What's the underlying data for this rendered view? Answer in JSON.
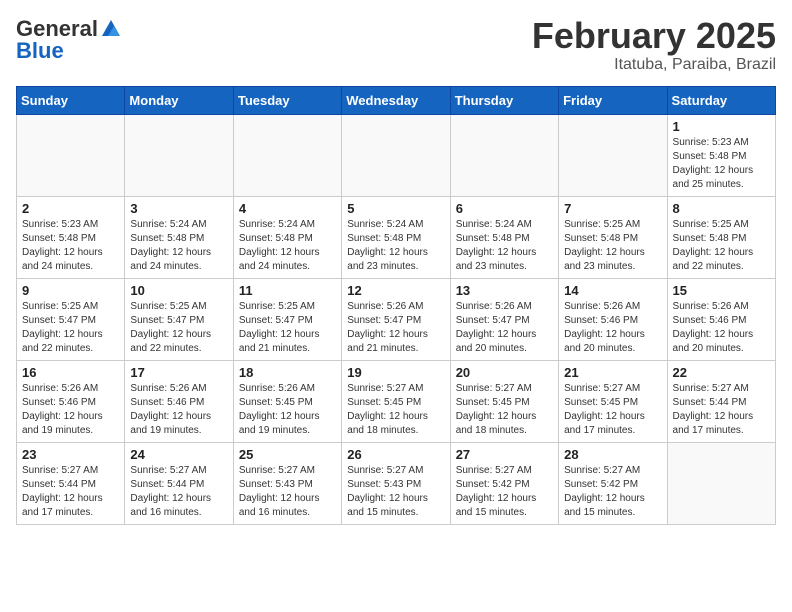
{
  "header": {
    "logo_general": "General",
    "logo_blue": "Blue",
    "cal_title": "February 2025",
    "cal_subtitle": "Itatuba, Paraiba, Brazil"
  },
  "weekdays": [
    "Sunday",
    "Monday",
    "Tuesday",
    "Wednesday",
    "Thursday",
    "Friday",
    "Saturday"
  ],
  "weeks": [
    [
      {
        "day": "",
        "info": ""
      },
      {
        "day": "",
        "info": ""
      },
      {
        "day": "",
        "info": ""
      },
      {
        "day": "",
        "info": ""
      },
      {
        "day": "",
        "info": ""
      },
      {
        "day": "",
        "info": ""
      },
      {
        "day": "1",
        "info": "Sunrise: 5:23 AM\nSunset: 5:48 PM\nDaylight: 12 hours and 25 minutes."
      }
    ],
    [
      {
        "day": "2",
        "info": "Sunrise: 5:23 AM\nSunset: 5:48 PM\nDaylight: 12 hours and 24 minutes."
      },
      {
        "day": "3",
        "info": "Sunrise: 5:24 AM\nSunset: 5:48 PM\nDaylight: 12 hours and 24 minutes."
      },
      {
        "day": "4",
        "info": "Sunrise: 5:24 AM\nSunset: 5:48 PM\nDaylight: 12 hours and 24 minutes."
      },
      {
        "day": "5",
        "info": "Sunrise: 5:24 AM\nSunset: 5:48 PM\nDaylight: 12 hours and 23 minutes."
      },
      {
        "day": "6",
        "info": "Sunrise: 5:24 AM\nSunset: 5:48 PM\nDaylight: 12 hours and 23 minutes."
      },
      {
        "day": "7",
        "info": "Sunrise: 5:25 AM\nSunset: 5:48 PM\nDaylight: 12 hours and 23 minutes."
      },
      {
        "day": "8",
        "info": "Sunrise: 5:25 AM\nSunset: 5:48 PM\nDaylight: 12 hours and 22 minutes."
      }
    ],
    [
      {
        "day": "9",
        "info": "Sunrise: 5:25 AM\nSunset: 5:47 PM\nDaylight: 12 hours and 22 minutes."
      },
      {
        "day": "10",
        "info": "Sunrise: 5:25 AM\nSunset: 5:47 PM\nDaylight: 12 hours and 22 minutes."
      },
      {
        "day": "11",
        "info": "Sunrise: 5:25 AM\nSunset: 5:47 PM\nDaylight: 12 hours and 21 minutes."
      },
      {
        "day": "12",
        "info": "Sunrise: 5:26 AM\nSunset: 5:47 PM\nDaylight: 12 hours and 21 minutes."
      },
      {
        "day": "13",
        "info": "Sunrise: 5:26 AM\nSunset: 5:47 PM\nDaylight: 12 hours and 20 minutes."
      },
      {
        "day": "14",
        "info": "Sunrise: 5:26 AM\nSunset: 5:46 PM\nDaylight: 12 hours and 20 minutes."
      },
      {
        "day": "15",
        "info": "Sunrise: 5:26 AM\nSunset: 5:46 PM\nDaylight: 12 hours and 20 minutes."
      }
    ],
    [
      {
        "day": "16",
        "info": "Sunrise: 5:26 AM\nSunset: 5:46 PM\nDaylight: 12 hours and 19 minutes."
      },
      {
        "day": "17",
        "info": "Sunrise: 5:26 AM\nSunset: 5:46 PM\nDaylight: 12 hours and 19 minutes."
      },
      {
        "day": "18",
        "info": "Sunrise: 5:26 AM\nSunset: 5:45 PM\nDaylight: 12 hours and 19 minutes."
      },
      {
        "day": "19",
        "info": "Sunrise: 5:27 AM\nSunset: 5:45 PM\nDaylight: 12 hours and 18 minutes."
      },
      {
        "day": "20",
        "info": "Sunrise: 5:27 AM\nSunset: 5:45 PM\nDaylight: 12 hours and 18 minutes."
      },
      {
        "day": "21",
        "info": "Sunrise: 5:27 AM\nSunset: 5:45 PM\nDaylight: 12 hours and 17 minutes."
      },
      {
        "day": "22",
        "info": "Sunrise: 5:27 AM\nSunset: 5:44 PM\nDaylight: 12 hours and 17 minutes."
      }
    ],
    [
      {
        "day": "23",
        "info": "Sunrise: 5:27 AM\nSunset: 5:44 PM\nDaylight: 12 hours and 17 minutes."
      },
      {
        "day": "24",
        "info": "Sunrise: 5:27 AM\nSunset: 5:44 PM\nDaylight: 12 hours and 16 minutes."
      },
      {
        "day": "25",
        "info": "Sunrise: 5:27 AM\nSunset: 5:43 PM\nDaylight: 12 hours and 16 minutes."
      },
      {
        "day": "26",
        "info": "Sunrise: 5:27 AM\nSunset: 5:43 PM\nDaylight: 12 hours and 15 minutes."
      },
      {
        "day": "27",
        "info": "Sunrise: 5:27 AM\nSunset: 5:42 PM\nDaylight: 12 hours and 15 minutes."
      },
      {
        "day": "28",
        "info": "Sunrise: 5:27 AM\nSunset: 5:42 PM\nDaylight: 12 hours and 15 minutes."
      },
      {
        "day": "",
        "info": ""
      }
    ]
  ]
}
